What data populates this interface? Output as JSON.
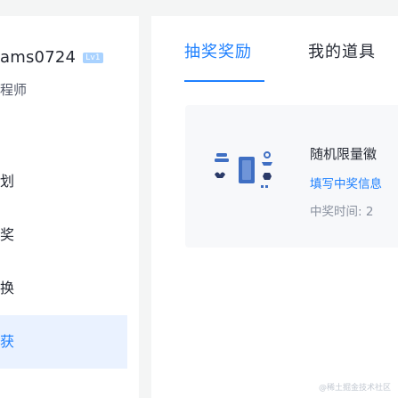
{
  "user": {
    "username": "ams0724",
    "level": "Lv1",
    "title": "程师"
  },
  "menu": [
    {
      "label": "划"
    },
    {
      "label": "奖"
    },
    {
      "label": "换"
    },
    {
      "label": "获",
      "active": true
    }
  ],
  "tabs": [
    {
      "label": "抽奖奖励",
      "active": true
    },
    {
      "label": "我的道具",
      "active": false
    }
  ],
  "prize": {
    "name": "随机限量徽",
    "action_link": "填写中奖信息",
    "time_label": "中奖时间:",
    "time_value": "2",
    "illustration": "badges-icon"
  },
  "watermark": "@稀土掘金技术社区",
  "colors": {
    "accent": "#1e80ff",
    "page_bg": "#f4f5f5",
    "active_menu_bg": "#eaf2ff",
    "badge_bg": "#a9d2ff",
    "icon_blue": "#3f6fc3",
    "icon_navy": "#2a3a68"
  }
}
